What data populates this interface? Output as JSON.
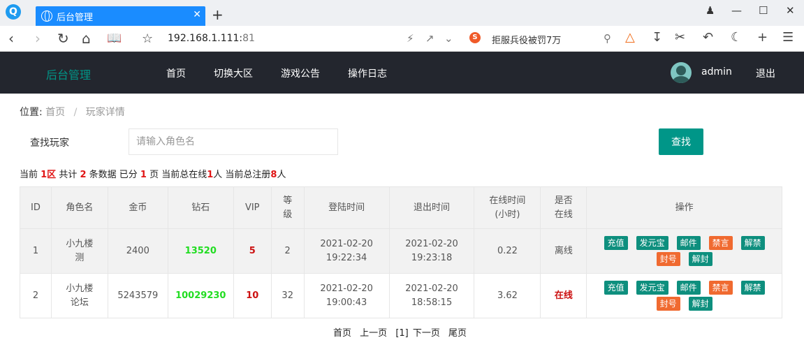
{
  "browser": {
    "tab_title": "后台管理",
    "tab_close": "✕",
    "new_tab": "+",
    "url_host": "192.168.1.111:",
    "url_port": "81",
    "search_engine_label": "S",
    "search_text": "拒服兵役被罚7万"
  },
  "header": {
    "logo": "后台管理",
    "nav": [
      "首页",
      "切换大区",
      "游戏公告",
      "操作日志"
    ],
    "username": "admin",
    "logout": "退出"
  },
  "breadcrumb": {
    "prefix": "位置:",
    "items": [
      "首页",
      "玩家详情"
    ],
    "separator": "/"
  },
  "search": {
    "label": "查找玩家",
    "placeholder": "请输入角色名",
    "button": "查找"
  },
  "summary": {
    "t1": "当前 ",
    "zone": "1区",
    "t2": " 共计 ",
    "count": "2",
    "t3": " 条数据 已分 ",
    "pages": "1",
    "t4": " 页 当前总在线",
    "online": "1",
    "t5": "人 当前总注册",
    "registered": "8",
    "t6": "人"
  },
  "table": {
    "headers": [
      "ID",
      "角色名",
      "金币",
      "钻石",
      "VIP",
      "等级",
      "登陆时间",
      "退出时间",
      "在线时间",
      "是否",
      "操作"
    ],
    "headers_line2": {
      "level": "级",
      "online_hours": "(小时)",
      "is_online": "在线"
    },
    "level_line1": "等",
    "rows": [
      {
        "id": "1",
        "name1": "小九楼",
        "name2": "测",
        "gold": "2400",
        "diamond": "13520",
        "vip": "5",
        "level": "2",
        "login_date": "2021-02-20",
        "login_time": "19:22:34",
        "logout_date": "2021-02-20",
        "logout_time": "19:23:18",
        "hours": "0.22",
        "status": "离线"
      },
      {
        "id": "2",
        "name1": "小九楼",
        "name2": "论坛",
        "gold": "5243579",
        "diamond": "10029230",
        "vip": "10",
        "level": "32",
        "login_date": "2021-02-20",
        "login_time": "19:00:43",
        "logout_date": "2021-02-20",
        "logout_time": "18:58:15",
        "hours": "3.62",
        "status": "在线"
      }
    ],
    "ops": [
      "充值",
      "发元宝",
      "邮件",
      "禁言",
      "解禁",
      "封号",
      "解封"
    ]
  },
  "pager": {
    "first": "首页",
    "prev": "上一页",
    "current": "[1]",
    "next": "下一页",
    "last": "尾页"
  },
  "colors": {
    "accent": "#009688",
    "header_bg": "#23262e",
    "tab_blue": "#1a8cff",
    "op_teal": "#0e8f7e",
    "op_orange": "#f06a30",
    "diamond_green": "#22dd22",
    "highlight_red": "#cc1111"
  }
}
